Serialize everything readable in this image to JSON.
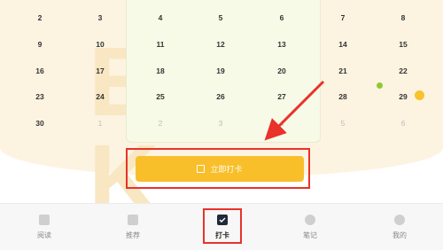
{
  "calendar": {
    "rows": [
      [
        {
          "d": "2",
          "m": false
        },
        {
          "d": "3",
          "m": false
        },
        {
          "d": "4",
          "m": false
        },
        {
          "d": "5",
          "m": false
        },
        {
          "d": "6",
          "m": false
        },
        {
          "d": "7",
          "m": false
        },
        {
          "d": "8",
          "m": false
        }
      ],
      [
        {
          "d": "9",
          "m": false
        },
        {
          "d": "10",
          "m": false
        },
        {
          "d": "11",
          "m": false
        },
        {
          "d": "12",
          "m": false
        },
        {
          "d": "13",
          "m": false
        },
        {
          "d": "14",
          "m": false
        },
        {
          "d": "15",
          "m": false
        }
      ],
      [
        {
          "d": "16",
          "m": false
        },
        {
          "d": "17",
          "m": false
        },
        {
          "d": "18",
          "m": false
        },
        {
          "d": "19",
          "m": false
        },
        {
          "d": "20",
          "m": false
        },
        {
          "d": "21",
          "m": false
        },
        {
          "d": "22",
          "m": false
        }
      ],
      [
        {
          "d": "23",
          "m": false
        },
        {
          "d": "24",
          "m": false
        },
        {
          "d": "25",
          "m": false
        },
        {
          "d": "26",
          "m": false
        },
        {
          "d": "27",
          "m": false
        },
        {
          "d": "28",
          "m": false
        },
        {
          "d": "29",
          "m": false
        }
      ],
      [
        {
          "d": "30",
          "m": false
        },
        {
          "d": "1",
          "m": true
        },
        {
          "d": "2",
          "m": true
        },
        {
          "d": "3",
          "m": true
        },
        {
          "d": "4",
          "m": true
        },
        {
          "d": "5",
          "m": true
        },
        {
          "d": "6",
          "m": true
        }
      ]
    ]
  },
  "cta": {
    "label": "立即打卡"
  },
  "nav": {
    "items": [
      {
        "label": "阅读",
        "icon": "book-icon"
      },
      {
        "label": "推荐",
        "icon": "recommend-icon"
      },
      {
        "label": "打卡",
        "icon": "checkin-icon",
        "active": true
      },
      {
        "label": "笔记",
        "icon": "note-icon"
      },
      {
        "label": "我的",
        "icon": "profile-icon"
      }
    ]
  },
  "colors": {
    "accent": "#f8bf2b",
    "highlight": "#e8322b",
    "bg": "#fdf3e1"
  }
}
